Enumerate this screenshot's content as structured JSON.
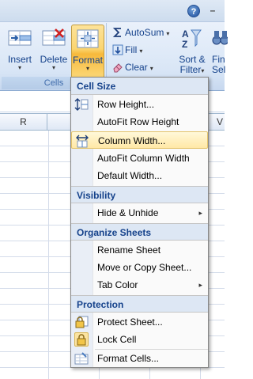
{
  "title_strip": {
    "help_glyph": "?",
    "minimize_glyph": "–"
  },
  "ribbon": {
    "cells_group": {
      "label": "Cells",
      "insert_label": "Insert",
      "delete_label": "Delete",
      "format_label": "Format",
      "arrow_glyph": "▾"
    },
    "editing": {
      "autosum_label": "AutoSum",
      "fill_label": "Fill",
      "clear_label": "Clear",
      "sort_filter_label_1": "Sort &",
      "sort_filter_label_2": "Filter",
      "find_select_label_1": "Fin",
      "find_select_label_2": "Sel",
      "caret_glyph": "▾"
    }
  },
  "sheet": {
    "columns": [
      "R",
      "",
      "",
      "",
      "V"
    ]
  },
  "format_menu": {
    "sections": {
      "cell_size": "Cell Size",
      "visibility": "Visibility",
      "organize": "Organize Sheets",
      "protection": "Protection"
    },
    "items": {
      "row_height": "Row Height...",
      "autofit_row": "AutoFit Row Height",
      "column_width": "Column Width...",
      "autofit_column": "AutoFit Column Width",
      "default_width": "Default Width...",
      "hide_unhide": "Hide & Unhide",
      "rename_sheet": "Rename Sheet",
      "move_copy": "Move or Copy Sheet...",
      "tab_color": "Tab Color",
      "protect_sheet": "Protect Sheet...",
      "lock_cell": "Lock Cell",
      "format_cells": "Format Cells..."
    },
    "submenu_glyph": "▸"
  },
  "colors": {
    "ribbon_text": "#15428b",
    "active_button": "#fbd570",
    "menu_hover": "#ffe8a6",
    "section_header_bg": "#dde7f4"
  }
}
